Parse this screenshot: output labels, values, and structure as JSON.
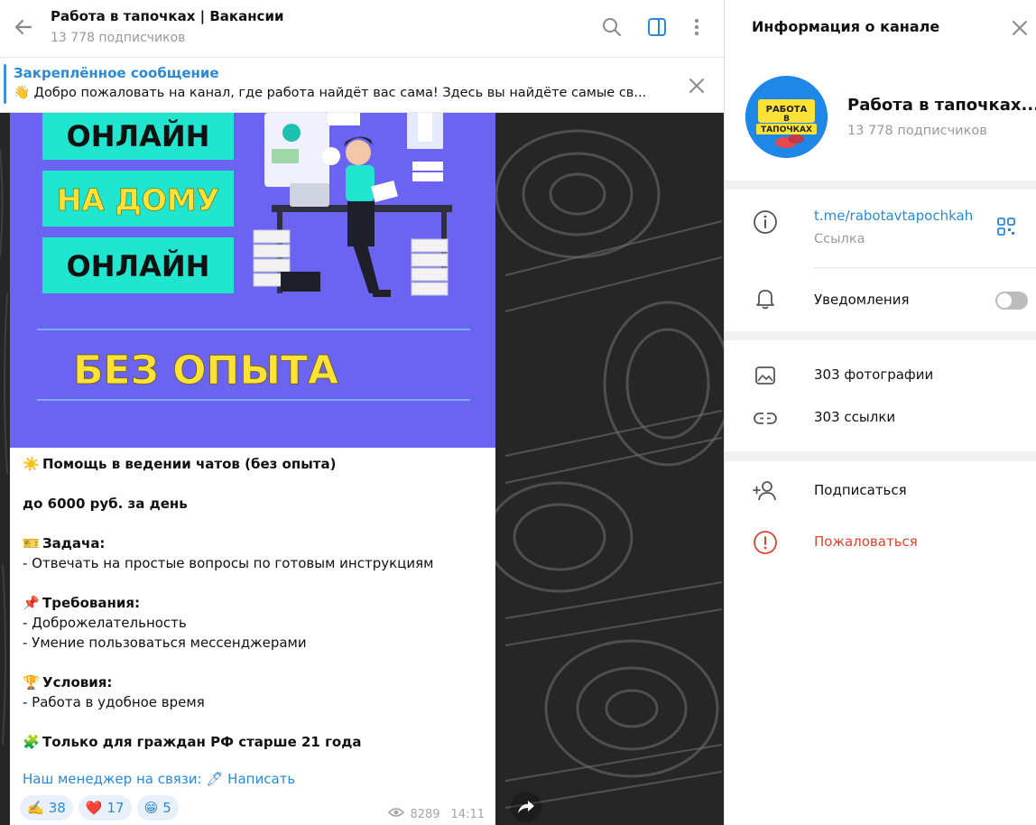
{
  "chat": {
    "title": "Работа в тапочках | Вакансии",
    "subscribers": "13 778 подписчиков"
  },
  "pinned": {
    "title": "Закреплённое сообщение",
    "text": "👋 Добро пожаловать на канал, где работа найдёт вас сама!  Здесь вы найдёте самые св..."
  },
  "post_image": {
    "line1": "ОНЛАЙН",
    "line2": "НА ДОМУ",
    "line3": "ОНЛАЙН",
    "bottom": "БЕЗ ОПЫТА"
  },
  "post": {
    "title_emoji": "☀️",
    "title": "Помощь в ведении чатов (без опыта)",
    "salary": "до 6000 руб. за день",
    "task_emoji": "🎫",
    "task_head": "Задача:",
    "task_item": "- Отвечать на простые вопросы по готовым инструкциям",
    "req_emoji": "📌",
    "req_head": "Требования:",
    "req_item1": "- Доброжелательность",
    "req_item2": "- Умение пользоваться мессенджерами",
    "cond_emoji": "🏆",
    "cond_head": "Условия:",
    "cond_item": "- Работа в удобное время",
    "citizen_emoji": "🧩",
    "citizen": "Только для граждан РФ старше 21 года",
    "manager_link": "Наш менеджер на связи: 🖊 Написать",
    "reactions": [
      {
        "emoji": "✍️",
        "count": "38"
      },
      {
        "emoji": "❤️",
        "count": "17"
      },
      {
        "emoji": "😁",
        "count": "5"
      }
    ],
    "views": "8289",
    "time": "14:11"
  },
  "info": {
    "header": "Информация о канале",
    "channel_name": "Работа в тапочках...",
    "subscribers": "13 778 подписчиков",
    "avatar_text1": "РАБОТА",
    "avatar_text2": "В",
    "avatar_text3": "ТАПОЧКАХ",
    "link": "t.me/rabotavtapochkah",
    "link_caption": "Ссылка",
    "notifications": "Уведомления",
    "photos": "303 фотографии",
    "links": "303 ссылки",
    "subscribe": "Подписаться",
    "report": "Пожаловаться"
  },
  "colors": {
    "accent": "#2a8ad6",
    "danger": "#e0442f",
    "poster_bg": "#6b64f2",
    "poster_box": "#20e6d0",
    "poster_yellow": "#ffe236"
  }
}
